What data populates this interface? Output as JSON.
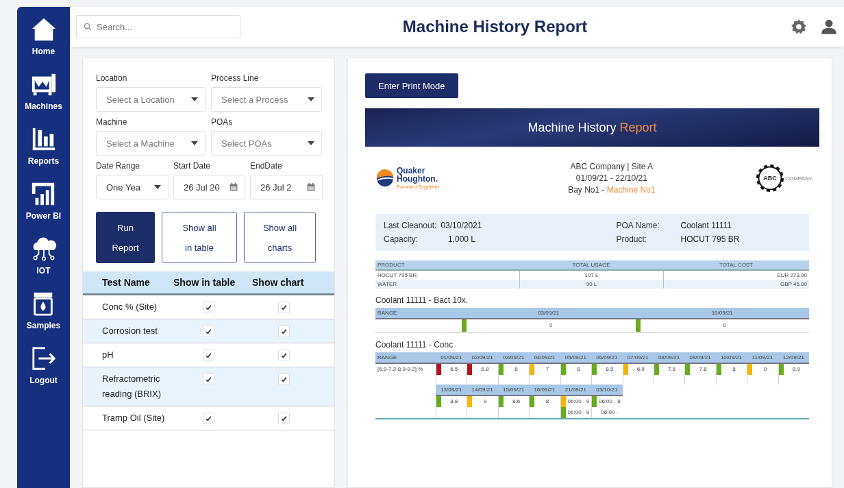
{
  "sidebar": {
    "items": [
      {
        "label": "Home"
      },
      {
        "label": "Machines"
      },
      {
        "label": "Reports"
      },
      {
        "label": "Power BI"
      },
      {
        "label": "IOT"
      },
      {
        "label": "Samples"
      },
      {
        "label": "Logout"
      }
    ]
  },
  "topbar": {
    "search": {
      "placeholder": "Search..."
    },
    "title": "Machine History Report"
  },
  "filters": {
    "rows": [
      [
        {
          "label": "Location",
          "placeholder": "Select a Location",
          "kind": "select"
        },
        {
          "label": "Process Line",
          "placeholder": "Select a Process",
          "kind": "select"
        }
      ],
      [
        {
          "label": "Machine",
          "placeholder": "Select a Machine",
          "kind": "select"
        },
        {
          "label": "POAs",
          "placeholder": "Select POAs",
          "kind": "select"
        }
      ],
      [
        {
          "label": "Date Range",
          "value": "One Yea",
          "kind": "select"
        },
        {
          "label": "Start Date",
          "value": "26 Jul 20",
          "kind": "date"
        },
        {
          "label": "EndDate",
          "value": "26 Jul 2",
          "kind": "date"
        }
      ]
    ],
    "buttons": [
      {
        "lines": [
          "Run",
          "Report"
        ],
        "kind": "primary"
      },
      {
        "lines": [
          "Show all",
          "in table"
        ],
        "kind": "outline"
      },
      {
        "lines": [
          "Show all",
          "charts"
        ],
        "kind": "outline"
      }
    ]
  },
  "tests": {
    "columns": [
      "Test Name",
      "Show in table",
      "Show chart"
    ],
    "rows": [
      {
        "name": "Conc % (Site)",
        "in_table": true,
        "chart": true
      },
      {
        "name": "Corrosion test",
        "in_table": true,
        "chart": true
      },
      {
        "name": "pH",
        "in_table": true,
        "chart": true
      },
      {
        "name": "Refractometric reading (BRIX)",
        "in_table": true,
        "chart": true
      },
      {
        "name": "Tramp Oil (Site)",
        "in_table": true,
        "chart": true
      }
    ]
  },
  "report": {
    "print_button": "Enter Print Mode",
    "banner": {
      "title": "Machine History",
      "accent": "Report"
    },
    "logo": {
      "name_1": "Quaker",
      "name_2": "Houghton.",
      "tagline": "Forward Together"
    },
    "company": {
      "line_1": "ABC Company  |  Site A",
      "line_2": "01/09/21 - 22/10/21",
      "bay": "Bay No1 - ",
      "machine": "Machine No1"
    },
    "company_logo": {
      "initials": "ABC",
      "word": "COMPANY"
    },
    "summary": {
      "last_cleanout_label": "Last Cleanout:",
      "last_cleanout": "03/10/2021",
      "capacity_label": "Capacity:",
      "capacity": "1,000 L",
      "poa_label": "POA Name:",
      "poa": "Coolant 11111",
      "product_label": "Product:",
      "product": "HOCUT 795 BR"
    },
    "usage": {
      "columns": [
        "PRODUCT",
        "TOTAL USAGE",
        "TOTAL COST"
      ],
      "rows": [
        [
          "HOCUT 795 BR",
          "107 L",
          "EUR 273.90"
        ],
        [
          "WATER",
          "90 L",
          "GBP 45.00"
        ]
      ]
    },
    "bact": {
      "title": "Coolant 11111 - Bact 10x.",
      "range_label": "RANGE",
      "cells": [
        {
          "date": "03/09/21",
          "value": "0",
          "color": "#6aab1e"
        },
        {
          "date": "10/09/21",
          "value": "0",
          "color": "#6aab1e"
        }
      ]
    },
    "conc": {
      "title": "Coolant 11111 - Conc",
      "range_label": "RANGE",
      "range": "[6.9-7.2-8.9-9.2] %",
      "rows": [
        [
          {
            "date": "01/09/21",
            "entries": [
              {
                "text": "6.5",
                "color": "#b5121b"
              }
            ]
          },
          {
            "date": "02/09/21",
            "entries": [
              {
                "text": "6.8",
                "color": "#b5121b"
              }
            ]
          },
          {
            "date": "03/09/21",
            "entries": [
              {
                "text": "8",
                "color": "#6aab1e"
              }
            ]
          },
          {
            "date": "04/09/21",
            "entries": [
              {
                "text": "7",
                "color": "#f2b705"
              }
            ]
          },
          {
            "date": "05/09/21",
            "entries": [
              {
                "text": "8",
                "color": "#6aab1e"
              }
            ]
          },
          {
            "date": "06/09/21",
            "entries": [
              {
                "text": "8.5",
                "color": "#6aab1e"
              }
            ]
          },
          {
            "date": "07/09/21",
            "entries": [
              {
                "text": "6.9",
                "color": "#f2b705"
              }
            ]
          },
          {
            "date": "08/09/21",
            "entries": [
              {
                "text": "7.6",
                "color": "#6aab1e"
              }
            ]
          },
          {
            "date": "09/09/21",
            "entries": [
              {
                "text": "7.8",
                "color": "#6aab1e"
              }
            ]
          },
          {
            "date": "10/09/21",
            "entries": [
              {
                "text": "8",
                "color": "#6aab1e"
              }
            ]
          },
          {
            "date": "11/09/21",
            "entries": [
              {
                "text": "9",
                "color": "#f2b705"
              }
            ]
          },
          {
            "date": "12/09/21",
            "entries": [
              {
                "text": "8.9",
                "color": "#6aab1e"
              }
            ]
          }
        ],
        [
          {
            "date": "13/09/21",
            "entries": [
              {
                "text": "8.8",
                "color": "#6aab1e"
              }
            ]
          },
          {
            "date": "14/09/21",
            "entries": [
              {
                "text": "9",
                "color": "#f2b705"
              }
            ]
          },
          {
            "date": "15/09/21",
            "entries": [
              {
                "text": "8.6",
                "color": "#6aab1e"
              }
            ]
          },
          {
            "date": "16/09/21",
            "entries": [
              {
                "text": "8",
                "color": "#6aab1e"
              }
            ]
          },
          {
            "date": "21/09/21",
            "entries": [
              {
                "text": "06:00 - 9",
                "color": "#f2b705"
              },
              {
                "text": "06:00 - 9",
                "color": "#6aab1e"
              }
            ]
          },
          {
            "date": "03/10/21",
            "entries": [
              {
                "text": "06:00 - 8",
                "color": "#6aab1e"
              },
              {
                "text": "06:00 -"
              }
            ]
          }
        ]
      ]
    }
  }
}
